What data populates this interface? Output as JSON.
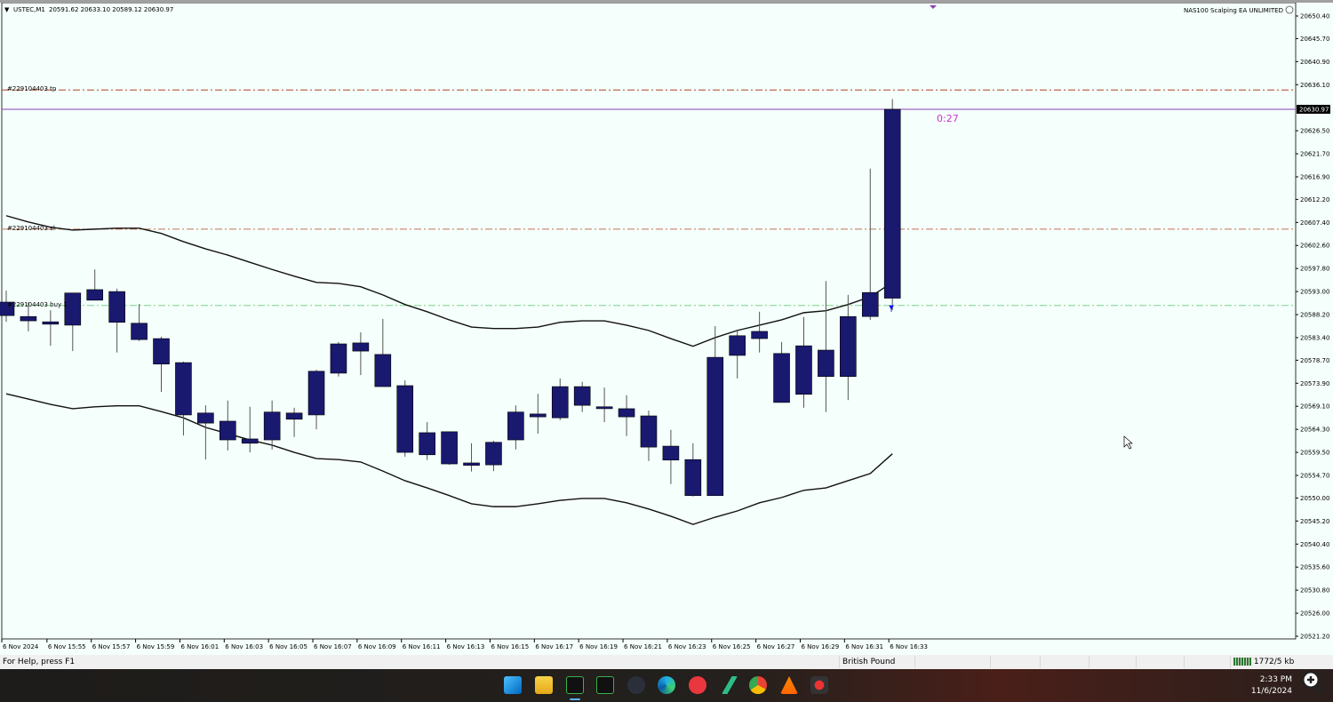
{
  "header": {
    "symbol": "USTEC,M1",
    "ohlc": "20591.62 20633.10 20589.12 20630.97",
    "ea_label": "NAS100 Scalping EA UNLIMITED",
    "ea_icon": "smiley-face-icon"
  },
  "orders": {
    "tp_label": "#229104403 tp",
    "tp_price": 20635.0,
    "sl_label": "#229104403 sl",
    "sl_price": 20606.0,
    "buy_label": "#229104403 buy 1",
    "buy_price": 20590.1
  },
  "current_price": {
    "label": "20630.97",
    "value": 20630.97
  },
  "countdown": "0:27",
  "colors": {
    "candle": "#191970",
    "band": "#111111",
    "tp_line": "#b5402a",
    "sl_line": "#c8705a",
    "buy_line": "#7fd08a",
    "price_line": "#8a3fb8",
    "countdown": "#cc33cc",
    "bg": "#f5fffb"
  },
  "price_axis": {
    "range": [
      20521.2,
      20650.4
    ],
    "ticks": [
      "20650.40",
      "20645.70",
      "20640.90",
      "20636.10",
      "20626.50",
      "20621.70",
      "20616.90",
      "20612.20",
      "20607.40",
      "20602.60",
      "20597.80",
      "20593.00",
      "20588.20",
      "20583.40",
      "20578.70",
      "20573.90",
      "20569.10",
      "20564.30",
      "20559.50",
      "20554.70",
      "20550.00",
      "20545.20",
      "20540.40",
      "20535.60",
      "20530.80",
      "20526.00",
      "20521.20"
    ]
  },
  "time_axis": {
    "labels": [
      "6 Nov 2024",
      "6 Nov 15:55",
      "6 Nov 15:57",
      "6 Nov 15:59",
      "6 Nov 16:01",
      "6 Nov 16:03",
      "6 Nov 16:05",
      "6 Nov 16:07",
      "6 Nov 16:09",
      "6 Nov 16:11",
      "6 Nov 16:13",
      "6 Nov 16:15",
      "6 Nov 16:17",
      "6 Nov 16:19",
      "6 Nov 16:21",
      "6 Nov 16:23",
      "6 Nov 16:25",
      "6 Nov 16:27",
      "6 Nov 16:29",
      "6 Nov 16:31",
      "6 Nov 16:33"
    ]
  },
  "chart_data": {
    "type": "candlestick",
    "title": "USTEC,M1",
    "ohlc_fields": [
      "open",
      "high",
      "low",
      "close"
    ],
    "candles": [
      [
        20590.8,
        20593.2,
        20586.7,
        20588.0
      ],
      [
        20587.8,
        20590.8,
        20584.7,
        20586.9
      ],
      [
        20586.2,
        20589.1,
        20581.7,
        20586.7
      ],
      [
        20586.0,
        20592.7,
        20580.6,
        20592.7
      ],
      [
        20591.2,
        20597.6,
        20591.2,
        20593.4
      ],
      [
        20593.0,
        20593.6,
        20580.3,
        20586.6
      ],
      [
        20586.4,
        20590.4,
        20582.7,
        20583.0
      ],
      [
        20583.2,
        20583.6,
        20572.1,
        20577.9
      ],
      [
        20578.2,
        20578.4,
        20563.0,
        20567.3
      ],
      [
        20567.7,
        20569.3,
        20558.0,
        20565.6
      ],
      [
        20566.0,
        20570.3,
        20559.9,
        20562.1
      ],
      [
        20562.3,
        20569.0,
        20559.5,
        20561.4
      ],
      [
        20562.1,
        20570.3,
        20560.1,
        20567.9
      ],
      [
        20566.4,
        20568.8,
        20562.7,
        20567.7
      ],
      [
        20567.3,
        20576.7,
        20564.3,
        20576.4
      ],
      [
        20576.0,
        20582.5,
        20575.3,
        20582.1
      ],
      [
        20582.3,
        20584.5,
        20575.6,
        20580.6
      ],
      [
        20579.9,
        20587.3,
        20573.2,
        20573.2
      ],
      [
        20573.4,
        20574.5,
        20558.6,
        20559.5
      ],
      [
        20563.6,
        20565.8,
        20557.9,
        20559.0
      ],
      [
        20563.8,
        20563.8,
        20556.9,
        20557.1
      ],
      [
        20556.8,
        20561.4,
        20555.5,
        20557.3
      ],
      [
        20556.9,
        20561.9,
        20555.6,
        20561.6
      ],
      [
        20562.1,
        20569.3,
        20560.1,
        20567.9
      ],
      [
        20566.9,
        20571.7,
        20563.4,
        20567.5
      ],
      [
        20566.7,
        20574.9,
        20566.2,
        20573.2
      ],
      [
        20573.2,
        20574.2,
        20567.9,
        20569.3
      ],
      [
        20569.0,
        20573.0,
        20565.8,
        20568.6
      ],
      [
        20568.6,
        20571.4,
        20562.9,
        20566.9
      ],
      [
        20567.1,
        20568.2,
        20557.7,
        20560.6
      ],
      [
        20560.8,
        20564.2,
        20552.9,
        20557.9
      ],
      [
        20558.0,
        20561.4,
        20550.3,
        20550.5
      ],
      [
        20550.5,
        20585.8,
        20550.5,
        20579.3
      ],
      [
        20579.7,
        20585.1,
        20574.9,
        20583.8
      ],
      [
        20583.2,
        20588.8,
        20580.3,
        20584.7
      ],
      [
        20580.1,
        20582.5,
        20569.9,
        20569.9
      ],
      [
        20571.6,
        20587.7,
        20568.8,
        20581.7
      ],
      [
        20580.8,
        20595.2,
        20567.9,
        20575.3
      ],
      [
        20575.3,
        20592.3,
        20570.4,
        20587.8
      ],
      [
        20587.8,
        20618.6,
        20587.1,
        20592.8
      ],
      [
        20591.62,
        20633.1,
        20589.12,
        20630.97
      ]
    ],
    "upper_band": [
      20608.8,
      20607.5,
      20606.4,
      20605.8,
      20606.0,
      20606.2,
      20606.2,
      20605.1,
      20603.4,
      20601.9,
      20600.6,
      20599.1,
      20597.6,
      20596.2,
      20594.9,
      20594.7,
      20594.0,
      20592.3,
      20590.3,
      20588.8,
      20587.1,
      20585.6,
      20585.3,
      20585.3,
      20585.6,
      20586.6,
      20586.9,
      20586.9,
      20586.0,
      20584.9,
      20583.2,
      20581.6,
      20583.4,
      20584.9,
      20586.0,
      20587.1,
      20588.6,
      20589.0,
      20590.3,
      20591.9,
      20594.9
    ],
    "lower_band": [
      20571.7,
      20570.6,
      20569.5,
      20568.6,
      20569.0,
      20569.2,
      20569.2,
      20568.0,
      20566.7,
      20564.7,
      20563.4,
      20562.1,
      20561.0,
      20559.5,
      20558.2,
      20558.0,
      20557.5,
      20555.6,
      20553.6,
      20552.1,
      20550.5,
      20548.8,
      20548.2,
      20548.2,
      20548.8,
      20549.5,
      20549.9,
      20549.9,
      20549.0,
      20547.7,
      20546.2,
      20544.5,
      20546.0,
      20547.3,
      20549.0,
      20550.1,
      20551.6,
      20552.1,
      20553.6,
      20555.1,
      20559.2
    ],
    "ylim": [
      20521.2,
      20650.4
    ],
    "xlabel": "",
    "ylabel": ""
  },
  "status_bar": {
    "help": "For Help, press F1",
    "account": "British Pound",
    "traffic": "1772/5 kb"
  },
  "taskbar": {
    "time": "2:33 PM",
    "date": "11/6/2024",
    "icons": [
      "windows-start",
      "file-explorer",
      "metatrader-1",
      "metatrader-2",
      "app-owl",
      "edge",
      "app-d",
      "tradingview",
      "chrome",
      "vlc",
      "recorder"
    ]
  }
}
